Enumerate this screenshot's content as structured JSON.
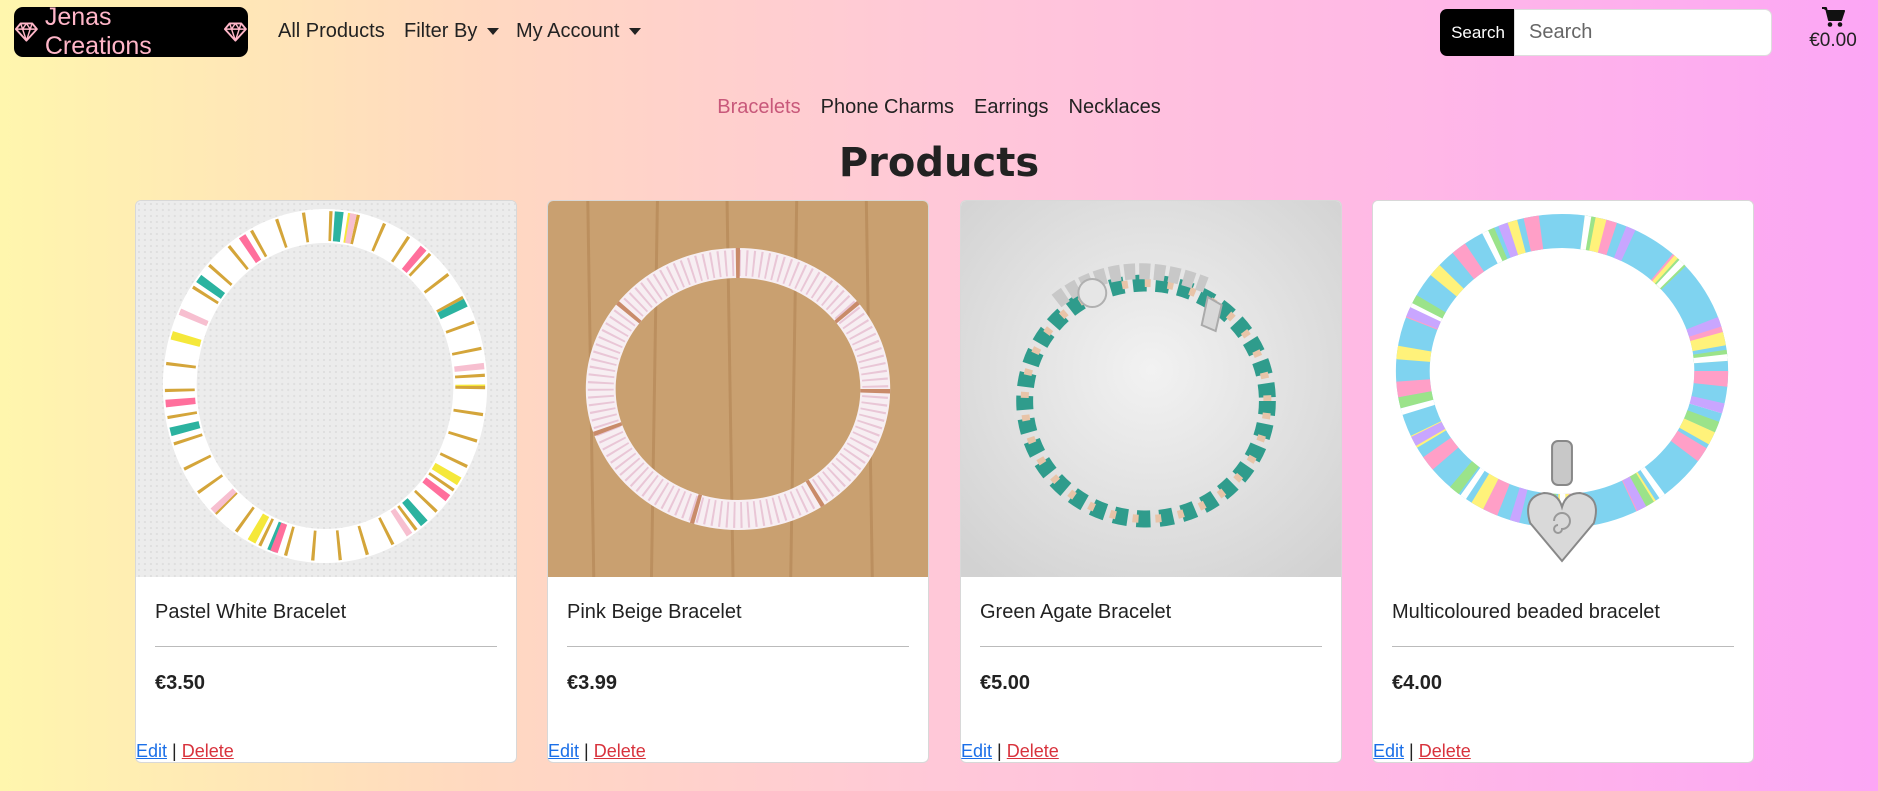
{
  "navbar": {
    "brand": "Jenas Creations",
    "links": [
      {
        "label": "All Products"
      },
      {
        "label": "Filter By"
      },
      {
        "label": "My Account"
      }
    ],
    "search_button": "Search",
    "search_placeholder": "Search",
    "cart_total": "€0.00"
  },
  "categories": {
    "items": [
      {
        "label": "Bracelets",
        "active": true
      },
      {
        "label": "Phone Charms"
      },
      {
        "label": "Earrings"
      },
      {
        "label": "Necklaces"
      }
    ]
  },
  "page_title": "Products",
  "products": [
    {
      "name": "Pastel White Bracelet",
      "price": "€3.50",
      "edit": "Edit",
      "sep": "|",
      "delete": "Delete"
    },
    {
      "name": "Pink Beige Bracelet",
      "price": "€3.99",
      "edit": "Edit",
      "sep": "|",
      "delete": "Delete"
    },
    {
      "name": "Green Agate Bracelet",
      "price": "€5.00",
      "edit": "Edit",
      "sep": "|",
      "delete": "Delete"
    },
    {
      "name": "Multicoloured beaded bracelet",
      "price": "€4.00",
      "edit": "Edit",
      "sep": "|",
      "delete": "Delete"
    }
  ],
  "colors": {
    "brand_bg": "#000000",
    "brand_text": "#ffb6c8",
    "active_category": "#c8587a",
    "edit_link": "#1a6fe8",
    "delete_link": "#d8323c"
  },
  "icons": [
    "gem-icon",
    "chevron-down-icon",
    "shopping-cart-icon"
  ]
}
